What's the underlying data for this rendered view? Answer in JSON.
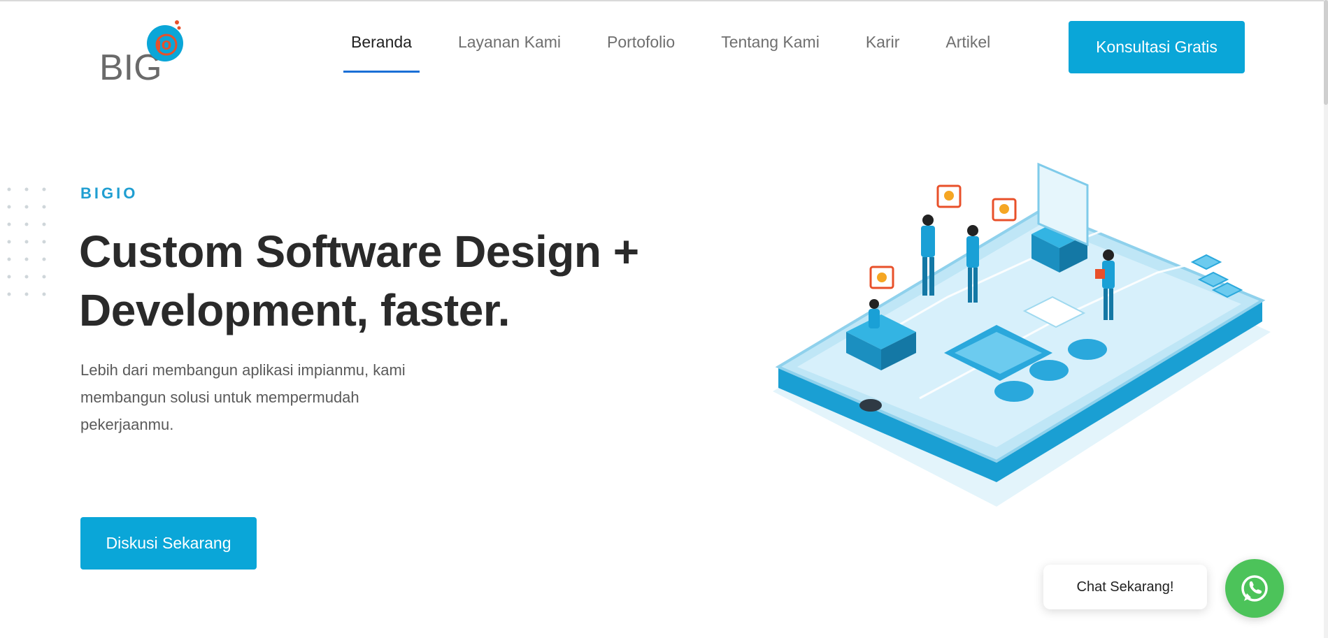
{
  "header": {
    "logo_text": "BIG",
    "logo_badge": "io",
    "nav": [
      {
        "label": "Beranda",
        "active": true
      },
      {
        "label": "Layanan Kami",
        "active": false
      },
      {
        "label": "Portofolio",
        "active": false
      },
      {
        "label": "Tentang Kami",
        "active": false
      },
      {
        "label": "Karir",
        "active": false
      },
      {
        "label": "Artikel",
        "active": false
      }
    ],
    "cta_label": "Konsultasi Gratis"
  },
  "hero": {
    "eyebrow": "BIGIO",
    "headline_line1": "Custom Software Design +",
    "headline_line2": "Development, faster.",
    "lead_line1": "Lebih dari membangun aplikasi impianmu, kami",
    "lead_line2": "membangun solusi untuk mempermudah",
    "lead_line3": "pekerjaanmu.",
    "button_label": "Diskusi Sekarang"
  },
  "chat": {
    "label": "Chat Sekarang!",
    "icon": "whatsapp-icon"
  },
  "colors": {
    "accent": "#0aa6d8",
    "nav_active_underline": "#1a6fd6",
    "logo_badge": "#0aa6d8",
    "logo_badge_ring": "#e8502a",
    "whatsapp": "#4cc35a"
  }
}
